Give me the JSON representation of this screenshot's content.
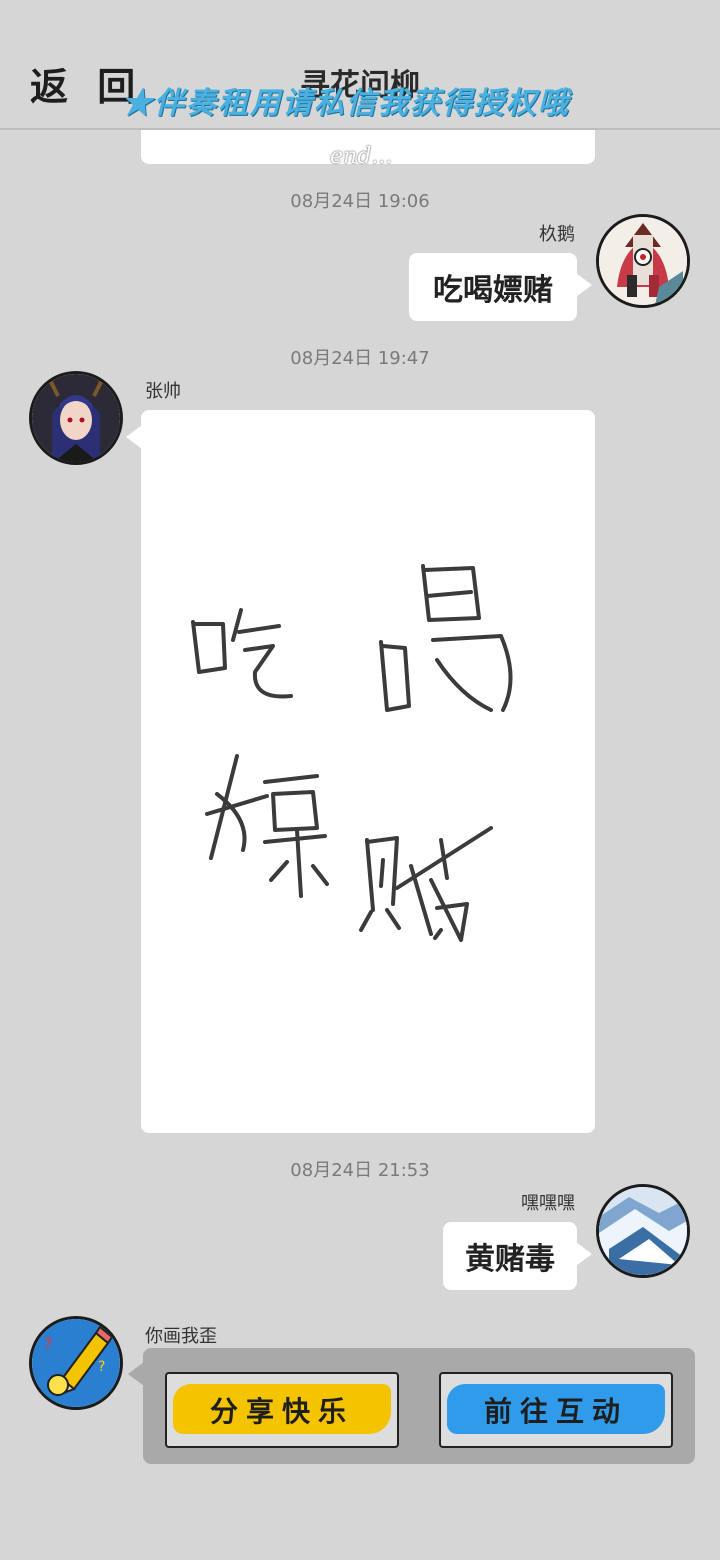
{
  "header": {
    "back_label": "返 回",
    "title": "寻花问柳",
    "watermark": "★伴奏租用请私信我获得授权哦"
  },
  "previous": {
    "end_text": "end..."
  },
  "messages": [
    {
      "time": "08月24日  19:06",
      "sender": "杦鹅",
      "text": "吃喝嫖赌",
      "side": "right"
    },
    {
      "time": "08月24日  19:47",
      "sender": "张帅",
      "type": "drawing",
      "side": "left"
    },
    {
      "time": "08月24日  21:53",
      "sender": "嘿嘿嘿",
      "text": "黄赌毒",
      "side": "right"
    }
  ],
  "game": {
    "sender": "你画我歪",
    "share_label": "分享快乐",
    "interact_label": "前往互动"
  },
  "colors": {
    "background": "#d6d6d6",
    "watermark": "#4ab0df",
    "share_button": "#f5c400",
    "interact_button": "#2f9bea"
  }
}
